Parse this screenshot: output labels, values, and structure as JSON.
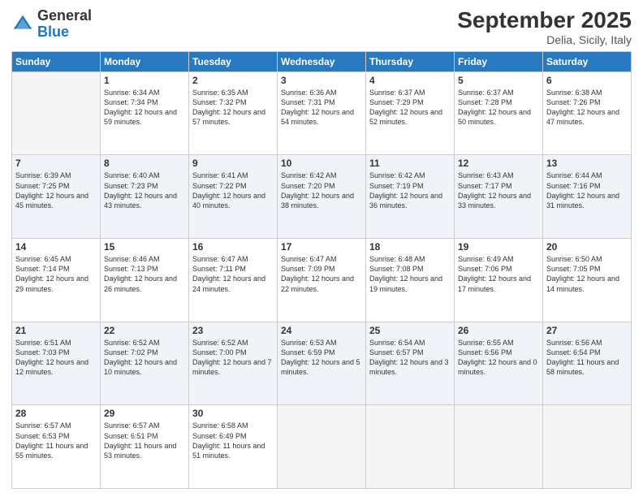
{
  "header": {
    "logo_general": "General",
    "logo_blue": "Blue",
    "month": "September 2025",
    "location": "Delia, Sicily, Italy"
  },
  "days_of_week": [
    "Sunday",
    "Monday",
    "Tuesday",
    "Wednesday",
    "Thursday",
    "Friday",
    "Saturday"
  ],
  "weeks": [
    [
      {
        "day": "",
        "sunrise": "",
        "sunset": "",
        "daylight": ""
      },
      {
        "day": "1",
        "sunrise": "Sunrise: 6:34 AM",
        "sunset": "Sunset: 7:34 PM",
        "daylight": "Daylight: 12 hours and 59 minutes."
      },
      {
        "day": "2",
        "sunrise": "Sunrise: 6:35 AM",
        "sunset": "Sunset: 7:32 PM",
        "daylight": "Daylight: 12 hours and 57 minutes."
      },
      {
        "day": "3",
        "sunrise": "Sunrise: 6:36 AM",
        "sunset": "Sunset: 7:31 PM",
        "daylight": "Daylight: 12 hours and 54 minutes."
      },
      {
        "day": "4",
        "sunrise": "Sunrise: 6:37 AM",
        "sunset": "Sunset: 7:29 PM",
        "daylight": "Daylight: 12 hours and 52 minutes."
      },
      {
        "day": "5",
        "sunrise": "Sunrise: 6:37 AM",
        "sunset": "Sunset: 7:28 PM",
        "daylight": "Daylight: 12 hours and 50 minutes."
      },
      {
        "day": "6",
        "sunrise": "Sunrise: 6:38 AM",
        "sunset": "Sunset: 7:26 PM",
        "daylight": "Daylight: 12 hours and 47 minutes."
      }
    ],
    [
      {
        "day": "7",
        "sunrise": "Sunrise: 6:39 AM",
        "sunset": "Sunset: 7:25 PM",
        "daylight": "Daylight: 12 hours and 45 minutes."
      },
      {
        "day": "8",
        "sunrise": "Sunrise: 6:40 AM",
        "sunset": "Sunset: 7:23 PM",
        "daylight": "Daylight: 12 hours and 43 minutes."
      },
      {
        "day": "9",
        "sunrise": "Sunrise: 6:41 AM",
        "sunset": "Sunset: 7:22 PM",
        "daylight": "Daylight: 12 hours and 40 minutes."
      },
      {
        "day": "10",
        "sunrise": "Sunrise: 6:42 AM",
        "sunset": "Sunset: 7:20 PM",
        "daylight": "Daylight: 12 hours and 38 minutes."
      },
      {
        "day": "11",
        "sunrise": "Sunrise: 6:42 AM",
        "sunset": "Sunset: 7:19 PM",
        "daylight": "Daylight: 12 hours and 36 minutes."
      },
      {
        "day": "12",
        "sunrise": "Sunrise: 6:43 AM",
        "sunset": "Sunset: 7:17 PM",
        "daylight": "Daylight: 12 hours and 33 minutes."
      },
      {
        "day": "13",
        "sunrise": "Sunrise: 6:44 AM",
        "sunset": "Sunset: 7:16 PM",
        "daylight": "Daylight: 12 hours and 31 minutes."
      }
    ],
    [
      {
        "day": "14",
        "sunrise": "Sunrise: 6:45 AM",
        "sunset": "Sunset: 7:14 PM",
        "daylight": "Daylight: 12 hours and 29 minutes."
      },
      {
        "day": "15",
        "sunrise": "Sunrise: 6:46 AM",
        "sunset": "Sunset: 7:13 PM",
        "daylight": "Daylight: 12 hours and 26 minutes."
      },
      {
        "day": "16",
        "sunrise": "Sunrise: 6:47 AM",
        "sunset": "Sunset: 7:11 PM",
        "daylight": "Daylight: 12 hours and 24 minutes."
      },
      {
        "day": "17",
        "sunrise": "Sunrise: 6:47 AM",
        "sunset": "Sunset: 7:09 PM",
        "daylight": "Daylight: 12 hours and 22 minutes."
      },
      {
        "day": "18",
        "sunrise": "Sunrise: 6:48 AM",
        "sunset": "Sunset: 7:08 PM",
        "daylight": "Daylight: 12 hours and 19 minutes."
      },
      {
        "day": "19",
        "sunrise": "Sunrise: 6:49 AM",
        "sunset": "Sunset: 7:06 PM",
        "daylight": "Daylight: 12 hours and 17 minutes."
      },
      {
        "day": "20",
        "sunrise": "Sunrise: 6:50 AM",
        "sunset": "Sunset: 7:05 PM",
        "daylight": "Daylight: 12 hours and 14 minutes."
      }
    ],
    [
      {
        "day": "21",
        "sunrise": "Sunrise: 6:51 AM",
        "sunset": "Sunset: 7:03 PM",
        "daylight": "Daylight: 12 hours and 12 minutes."
      },
      {
        "day": "22",
        "sunrise": "Sunrise: 6:52 AM",
        "sunset": "Sunset: 7:02 PM",
        "daylight": "Daylight: 12 hours and 10 minutes."
      },
      {
        "day": "23",
        "sunrise": "Sunrise: 6:52 AM",
        "sunset": "Sunset: 7:00 PM",
        "daylight": "Daylight: 12 hours and 7 minutes."
      },
      {
        "day": "24",
        "sunrise": "Sunrise: 6:53 AM",
        "sunset": "Sunset: 6:59 PM",
        "daylight": "Daylight: 12 hours and 5 minutes."
      },
      {
        "day": "25",
        "sunrise": "Sunrise: 6:54 AM",
        "sunset": "Sunset: 6:57 PM",
        "daylight": "Daylight: 12 hours and 3 minutes."
      },
      {
        "day": "26",
        "sunrise": "Sunrise: 6:55 AM",
        "sunset": "Sunset: 6:56 PM",
        "daylight": "Daylight: 12 hours and 0 minutes."
      },
      {
        "day": "27",
        "sunrise": "Sunrise: 6:56 AM",
        "sunset": "Sunset: 6:54 PM",
        "daylight": "Daylight: 11 hours and 58 minutes."
      }
    ],
    [
      {
        "day": "28",
        "sunrise": "Sunrise: 6:57 AM",
        "sunset": "Sunset: 6:53 PM",
        "daylight": "Daylight: 11 hours and 55 minutes."
      },
      {
        "day": "29",
        "sunrise": "Sunrise: 6:57 AM",
        "sunset": "Sunset: 6:51 PM",
        "daylight": "Daylight: 11 hours and 53 minutes."
      },
      {
        "day": "30",
        "sunrise": "Sunrise: 6:58 AM",
        "sunset": "Sunset: 6:49 PM",
        "daylight": "Daylight: 11 hours and 51 minutes."
      },
      {
        "day": "",
        "sunrise": "",
        "sunset": "",
        "daylight": ""
      },
      {
        "day": "",
        "sunrise": "",
        "sunset": "",
        "daylight": ""
      },
      {
        "day": "",
        "sunrise": "",
        "sunset": "",
        "daylight": ""
      },
      {
        "day": "",
        "sunrise": "",
        "sunset": "",
        "daylight": ""
      }
    ]
  ]
}
